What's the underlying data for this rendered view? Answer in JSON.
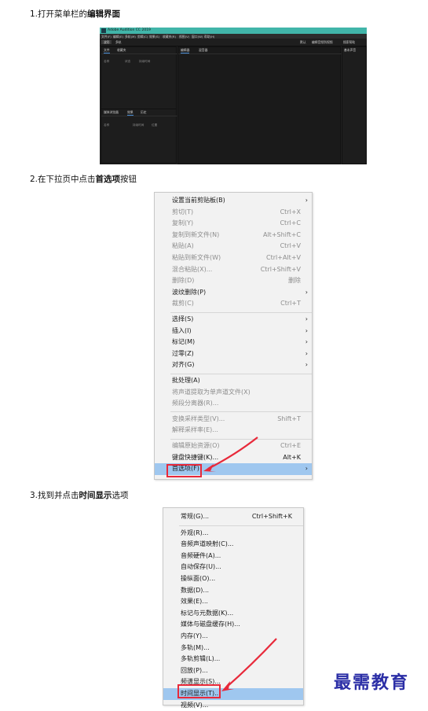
{
  "steps": [
    {
      "prefix": "1.打开菜单栏的",
      "bold": "编辑界面",
      "suffix": ""
    },
    {
      "prefix": "2.在下拉页中点击",
      "bold": "首选项",
      "suffix": "按钮"
    },
    {
      "prefix": "3.找到并点击",
      "bold": "时间显示",
      "suffix": "选项"
    }
  ],
  "audition": {
    "title": "Adobe Audition CC 2019",
    "menus": [
      "文件(F)",
      "编辑(E)",
      "多轨(M)",
      "剪辑(C)",
      "效果(S)",
      "收藏夹(R)",
      "视图(V)",
      "窗口(W)",
      "帮助(H)"
    ],
    "toolbar": {
      "waveform": "波形",
      "multitrack": "多轨",
      "workspace": "默认",
      "edit_audio": "编辑音频到视频",
      "search": "搜索帮助"
    },
    "left_tabs": [
      "文件",
      "收藏夹"
    ],
    "left_cols": [
      "名称",
      "状态",
      "持续时间"
    ],
    "mid_tabs": [
      "编辑器",
      "混音器"
    ],
    "lower_tabs": [
      "媒体浏览器",
      "效果",
      "历史"
    ],
    "lower_cols": [
      "名称",
      "持续时间",
      "位置"
    ],
    "right_tab": "基本声音"
  },
  "edit_menu": {
    "items": [
      {
        "label": "设置当前剪贴板(B)",
        "shortcut": "",
        "arrow": true,
        "disabled": false
      },
      {
        "label": "剪切(T)",
        "shortcut": "Ctrl+X",
        "arrow": false,
        "disabled": true
      },
      {
        "label": "复制(Y)",
        "shortcut": "Ctrl+C",
        "arrow": false,
        "disabled": true
      },
      {
        "label": "复制到新文件(N)",
        "shortcut": "Alt+Shift+C",
        "arrow": false,
        "disabled": true
      },
      {
        "label": "粘贴(A)",
        "shortcut": "Ctrl+V",
        "arrow": false,
        "disabled": true
      },
      {
        "label": "粘贴到新文件(W)",
        "shortcut": "Ctrl+Alt+V",
        "arrow": false,
        "disabled": true
      },
      {
        "label": "混合粘贴(X)...",
        "shortcut": "Ctrl+Shift+V",
        "arrow": false,
        "disabled": true
      },
      {
        "label": "删除(D)",
        "shortcut": "删除",
        "arrow": false,
        "disabled": true
      },
      {
        "label": "波纹删除(P)",
        "shortcut": "",
        "arrow": true,
        "disabled": false
      },
      {
        "label": "裁剪(C)",
        "shortcut": "Ctrl+T",
        "arrow": false,
        "disabled": true
      },
      {
        "sep": true
      },
      {
        "label": "选择(S)",
        "shortcut": "",
        "arrow": true,
        "disabled": false
      },
      {
        "label": "插入(I)",
        "shortcut": "",
        "arrow": true,
        "disabled": false
      },
      {
        "label": "标记(M)",
        "shortcut": "",
        "arrow": true,
        "disabled": false
      },
      {
        "label": "过零(Z)",
        "shortcut": "",
        "arrow": true,
        "disabled": false
      },
      {
        "label": "对齐(G)",
        "shortcut": "",
        "arrow": true,
        "disabled": false
      },
      {
        "sep": true
      },
      {
        "label": "批处理(A)",
        "shortcut": "",
        "arrow": false,
        "disabled": false
      },
      {
        "label": "将声道提取为单声道文件(X)",
        "shortcut": "",
        "arrow": false,
        "disabled": true
      },
      {
        "label": "频段分离器(R)...",
        "shortcut": "",
        "arrow": false,
        "disabled": true
      },
      {
        "sep": true
      },
      {
        "label": "变换采样类型(V)...",
        "shortcut": "Shift+T",
        "arrow": false,
        "disabled": true
      },
      {
        "label": "解释采样率(E)...",
        "shortcut": "",
        "arrow": false,
        "disabled": true
      },
      {
        "sep": true
      },
      {
        "label": "编辑原始资源(O)",
        "shortcut": "Ctrl+E",
        "arrow": false,
        "disabled": true
      },
      {
        "label": "键盘快捷键(K)...",
        "shortcut": "Alt+K",
        "arrow": false,
        "disabled": false
      },
      {
        "label": "首选项(F)",
        "shortcut": "",
        "arrow": true,
        "disabled": false,
        "highlight": true
      }
    ]
  },
  "prefs_menu": {
    "items": [
      {
        "label": "常规(G)...",
        "shortcut": "Ctrl+Shift+K"
      },
      {
        "sep": true
      },
      {
        "label": "外观(R)...",
        "shortcut": ""
      },
      {
        "label": "音频声道映射(C)...",
        "shortcut": ""
      },
      {
        "label": "音频硬件(A)...",
        "shortcut": ""
      },
      {
        "label": "自动保存(U)...",
        "shortcut": ""
      },
      {
        "label": "操纵面(O)...",
        "shortcut": ""
      },
      {
        "label": "数据(D)...",
        "shortcut": ""
      },
      {
        "label": "效果(E)...",
        "shortcut": ""
      },
      {
        "label": "标记与元数据(K)...",
        "shortcut": ""
      },
      {
        "label": "媒体与磁盘缓存(H)...",
        "shortcut": ""
      },
      {
        "label": "内存(Y)...",
        "shortcut": ""
      },
      {
        "label": "多轨(M)...",
        "shortcut": ""
      },
      {
        "label": "多轨剪辑(L)...",
        "shortcut": ""
      },
      {
        "label": "回放(P)...",
        "shortcut": ""
      },
      {
        "label": "频谱显示(S)...",
        "shortcut": ""
      },
      {
        "label": "时间显示(T)...",
        "shortcut": "",
        "highlight": true
      },
      {
        "label": "视频(V)...",
        "shortcut": ""
      }
    ]
  },
  "brand": "最需教育"
}
